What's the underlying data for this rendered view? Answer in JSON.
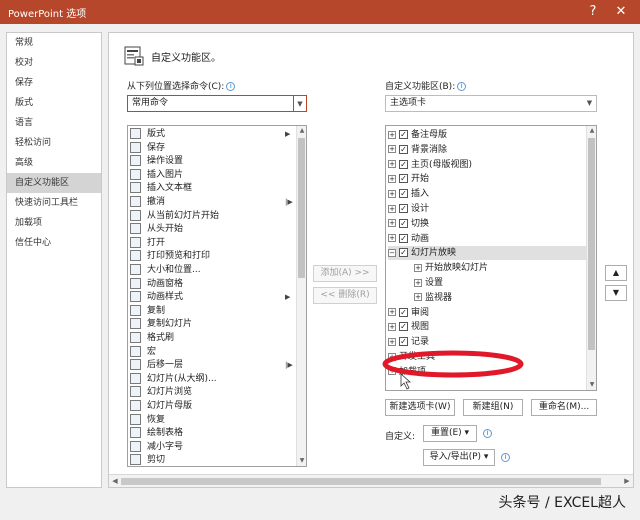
{
  "window": {
    "title": "PowerPoint 选项",
    "help_glyph": "?",
    "close_glyph": "✕"
  },
  "nav": {
    "items": [
      {
        "label": "常规",
        "active": false
      },
      {
        "label": "校对",
        "active": false
      },
      {
        "label": "保存",
        "active": false
      },
      {
        "label": "版式",
        "active": false
      },
      {
        "label": "语言",
        "active": false
      },
      {
        "label": "轻松访问",
        "active": false
      },
      {
        "label": "高级",
        "active": false
      },
      {
        "label": "自定义功能区",
        "active": true
      },
      {
        "label": "快速访问工具栏",
        "active": false
      },
      {
        "label": "加载项",
        "active": false
      },
      {
        "label": "信任中心",
        "active": false
      }
    ]
  },
  "main": {
    "heading": "自定义功能区。",
    "choose_from_label": "从下列位置选择命令(C):",
    "choose_from_value": "常用命令",
    "customize_label": "自定义功能区(B):",
    "customize_value": "主选项卡",
    "info_glyph": "i"
  },
  "commands": {
    "items": [
      {
        "label": "版式",
        "icon": "layout-icon",
        "submenu": "▶"
      },
      {
        "label": "保存",
        "icon": "save-icon",
        "submenu": ""
      },
      {
        "label": "操作设置",
        "icon": "star-icon",
        "submenu": ""
      },
      {
        "label": "插入图片",
        "icon": "picture-icon",
        "submenu": ""
      },
      {
        "label": "插入文本框",
        "icon": "textbox-icon",
        "submenu": ""
      },
      {
        "label": "撤消",
        "icon": "undo-icon",
        "submenu": "|▶"
      },
      {
        "label": "从当前幻灯片开始",
        "icon": "slideshow-current-icon",
        "submenu": ""
      },
      {
        "label": "从头开始",
        "icon": "slideshow-start-icon",
        "submenu": ""
      },
      {
        "label": "打开",
        "icon": "folder-icon",
        "submenu": ""
      },
      {
        "label": "打印预览和打印",
        "icon": "print-preview-icon",
        "submenu": ""
      },
      {
        "label": "大小和位置...",
        "icon": "size-position-icon",
        "submenu": ""
      },
      {
        "label": "动画窗格",
        "icon": "animation-pane-icon",
        "submenu": ""
      },
      {
        "label": "动画样式",
        "icon": "animation-style-icon",
        "submenu": "▶"
      },
      {
        "label": "复制",
        "icon": "copy-icon",
        "submenu": ""
      },
      {
        "label": "复制幻灯片",
        "icon": "duplicate-slide-icon",
        "submenu": ""
      },
      {
        "label": "格式刷",
        "icon": "format-painter-icon",
        "submenu": ""
      },
      {
        "label": "宏",
        "icon": "macro-icon",
        "submenu": ""
      },
      {
        "label": "后移一层",
        "icon": "send-backward-icon",
        "submenu": "|▶"
      },
      {
        "label": "幻灯片(从大纲)...",
        "icon": "slides-outline-icon",
        "submenu": ""
      },
      {
        "label": "幻灯片浏览",
        "icon": "slide-sorter-icon",
        "submenu": ""
      },
      {
        "label": "幻灯片母版",
        "icon": "slide-master-icon",
        "submenu": ""
      },
      {
        "label": "恢复",
        "icon": "redo-icon",
        "submenu": ""
      },
      {
        "label": "绘制表格",
        "icon": "draw-table-icon",
        "submenu": ""
      },
      {
        "label": "减小字号",
        "icon": "decrease-font-icon",
        "submenu": ""
      },
      {
        "label": "剪切",
        "icon": "cut-icon",
        "submenu": ""
      }
    ]
  },
  "tabs_tree": {
    "items": [
      {
        "label": "备注母版",
        "level": 0,
        "expander": "+",
        "checkbox": true,
        "selected": false
      },
      {
        "label": "背景消除",
        "level": 0,
        "expander": "+",
        "checkbox": true,
        "selected": false
      },
      {
        "label": "主页(母版视图)",
        "level": 0,
        "expander": "+",
        "checkbox": true,
        "selected": false
      },
      {
        "label": "开始",
        "level": 0,
        "expander": "+",
        "checkbox": true,
        "selected": false
      },
      {
        "label": "插入",
        "level": 0,
        "expander": "+",
        "checkbox": true,
        "selected": false
      },
      {
        "label": "设计",
        "level": 0,
        "expander": "+",
        "checkbox": true,
        "selected": false
      },
      {
        "label": "切换",
        "level": 0,
        "expander": "+",
        "checkbox": true,
        "selected": false
      },
      {
        "label": "动画",
        "level": 0,
        "expander": "+",
        "checkbox": true,
        "selected": false
      },
      {
        "label": "幻灯片放映",
        "level": 0,
        "expander": "−",
        "checkbox": true,
        "selected": true
      },
      {
        "label": "开始放映幻灯片",
        "level": 1,
        "expander": "+",
        "checkbox": false,
        "selected": false
      },
      {
        "label": "设置",
        "level": 1,
        "expander": "+",
        "checkbox": false,
        "selected": false
      },
      {
        "label": "监视器",
        "level": 1,
        "expander": "+",
        "checkbox": false,
        "selected": false
      },
      {
        "label": "审阅",
        "level": 0,
        "expander": "+",
        "checkbox": true,
        "selected": false
      },
      {
        "label": "视图",
        "level": 0,
        "expander": "+",
        "checkbox": true,
        "selected": false
      },
      {
        "label": "记录",
        "level": 0,
        "expander": "+",
        "checkbox": true,
        "selected": false
      },
      {
        "label": "开发工具",
        "level": 0,
        "expander": "+",
        "checkbox": false,
        "selected": false
      },
      {
        "label": "加载项",
        "level": 0,
        "expander": "+",
        "checkbox": false,
        "selected": false
      }
    ]
  },
  "buttons": {
    "add": "添加(A) >>",
    "remove": "<< 删除(R)",
    "new_tab": "新建选项卡(W)",
    "new_group": "新建组(N)",
    "rename": "重命名(M)...",
    "move_up": "▲",
    "move_down": "▼"
  },
  "customizations": {
    "label": "自定义:",
    "reset_button": "重置(E) ▾",
    "import_export_button": "导入/导出(P) ▾"
  },
  "watermark": "头条号 / EXCEL超人"
}
